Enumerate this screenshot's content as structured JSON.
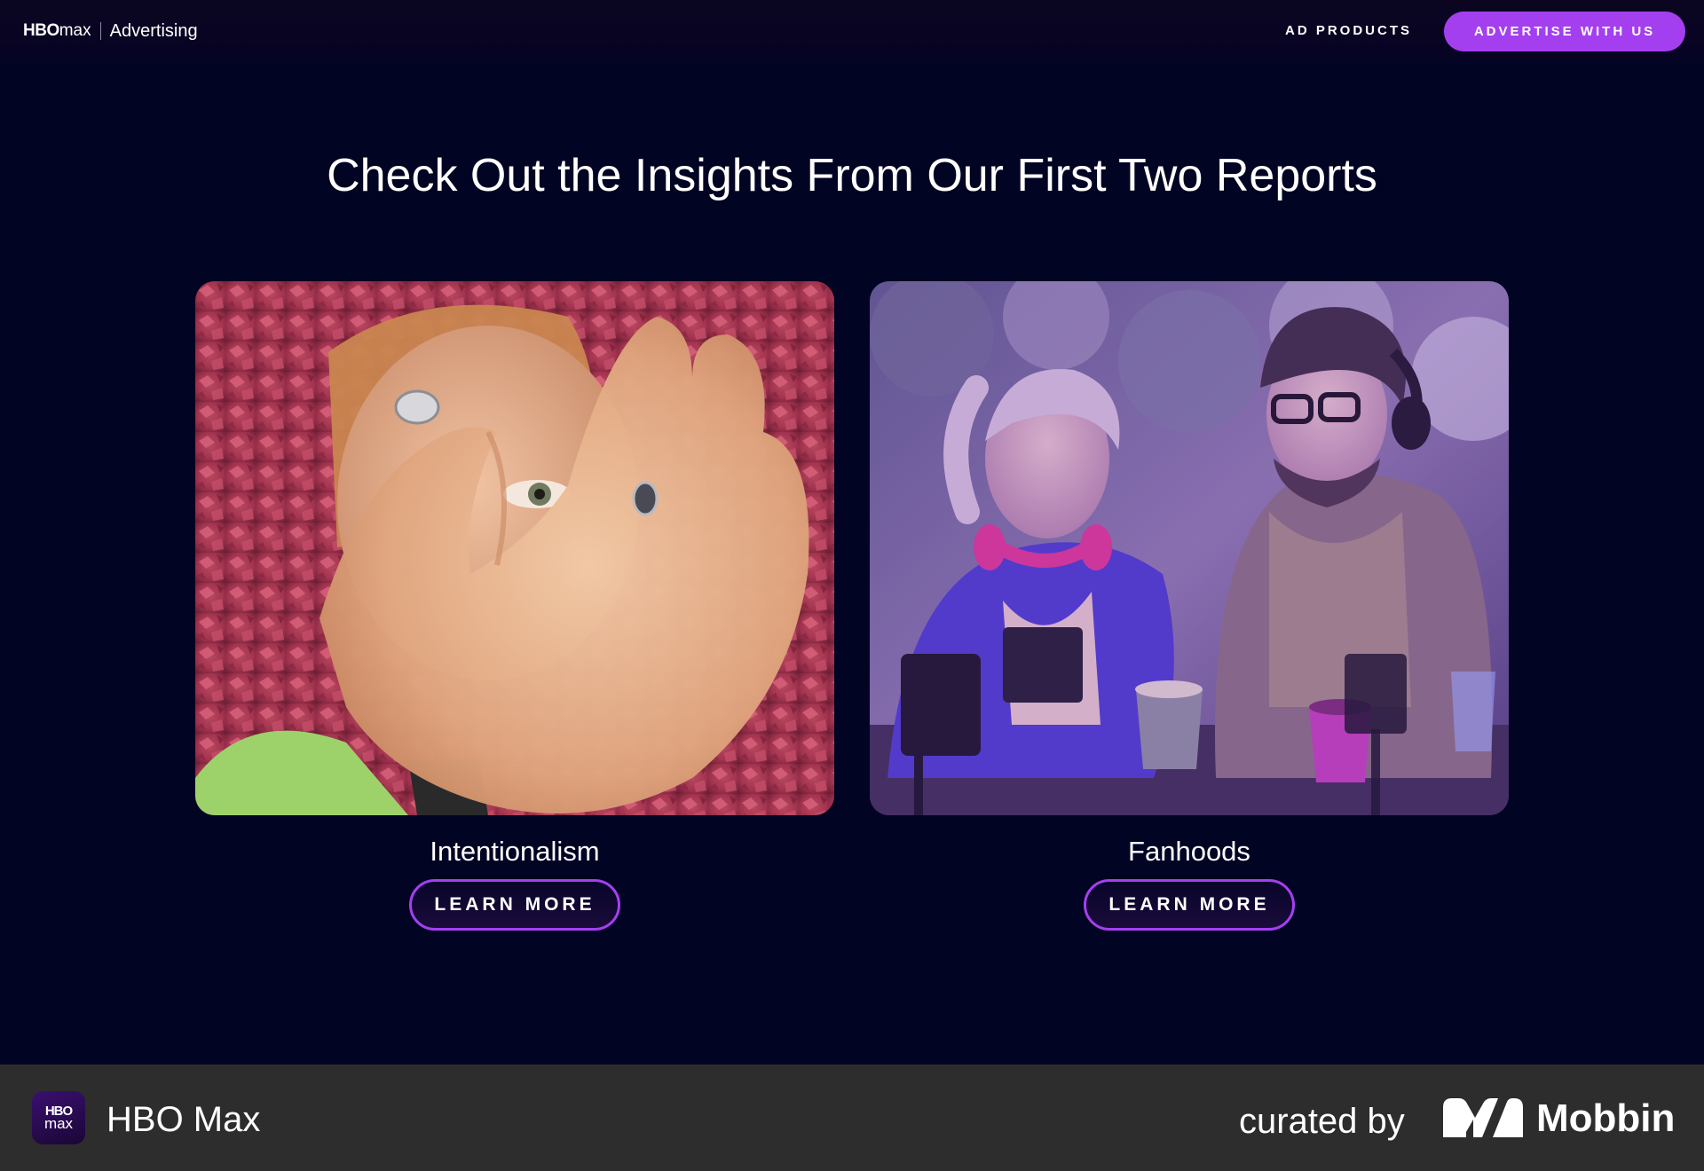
{
  "nav": {
    "brand_logo_hbo": "HBO",
    "brand_logo_max": "max",
    "brand_sub": "Advertising",
    "link_ad_products": "AD PRODUCTS",
    "cta": "ADVERTISE WITH US"
  },
  "main": {
    "headline": "Check Out the Insights From Our First Two Reports",
    "cards": [
      {
        "title": "Intentionalism",
        "button": "LEARN MORE",
        "image_icon": "photo-woman-hand-heart"
      },
      {
        "title": "Fanhoods",
        "button": "LEARN MORE",
        "image_icon": "photo-friends-cafe"
      }
    ]
  },
  "credit": {
    "app_icon_top": "HBO",
    "app_icon_bottom": "max",
    "app_name": "HBO Max",
    "curated_by": "curated by",
    "mobbin": "Mobbin"
  },
  "colors": {
    "background": "#020423",
    "accent": "#a43ff0",
    "credit_bar": "#2d2d2d"
  }
}
